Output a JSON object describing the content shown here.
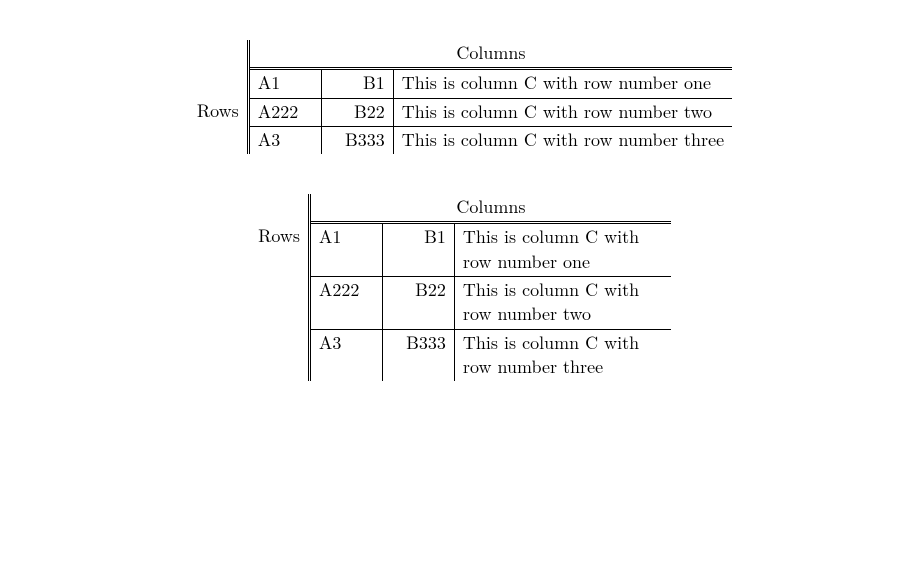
{
  "labels": {
    "columns": "Columns",
    "rows": "Rows"
  },
  "table1": {
    "rows": [
      {
        "a": "A1",
        "b": "B1",
        "c": "This is column C with row number one"
      },
      {
        "a": "A222",
        "b": "B22",
        "c": "This is column C with row number two"
      },
      {
        "a": "A3",
        "b": "B333",
        "c": "This is column C with row number three"
      }
    ]
  },
  "table2": {
    "rows": [
      {
        "a": "A1",
        "b": "B1",
        "c": "This is column C with row number one"
      },
      {
        "a": "A222",
        "b": "B22",
        "c": "This is column C with row number two"
      },
      {
        "a": "A3",
        "b": "B333",
        "c": "This is column C with row number three"
      }
    ]
  }
}
